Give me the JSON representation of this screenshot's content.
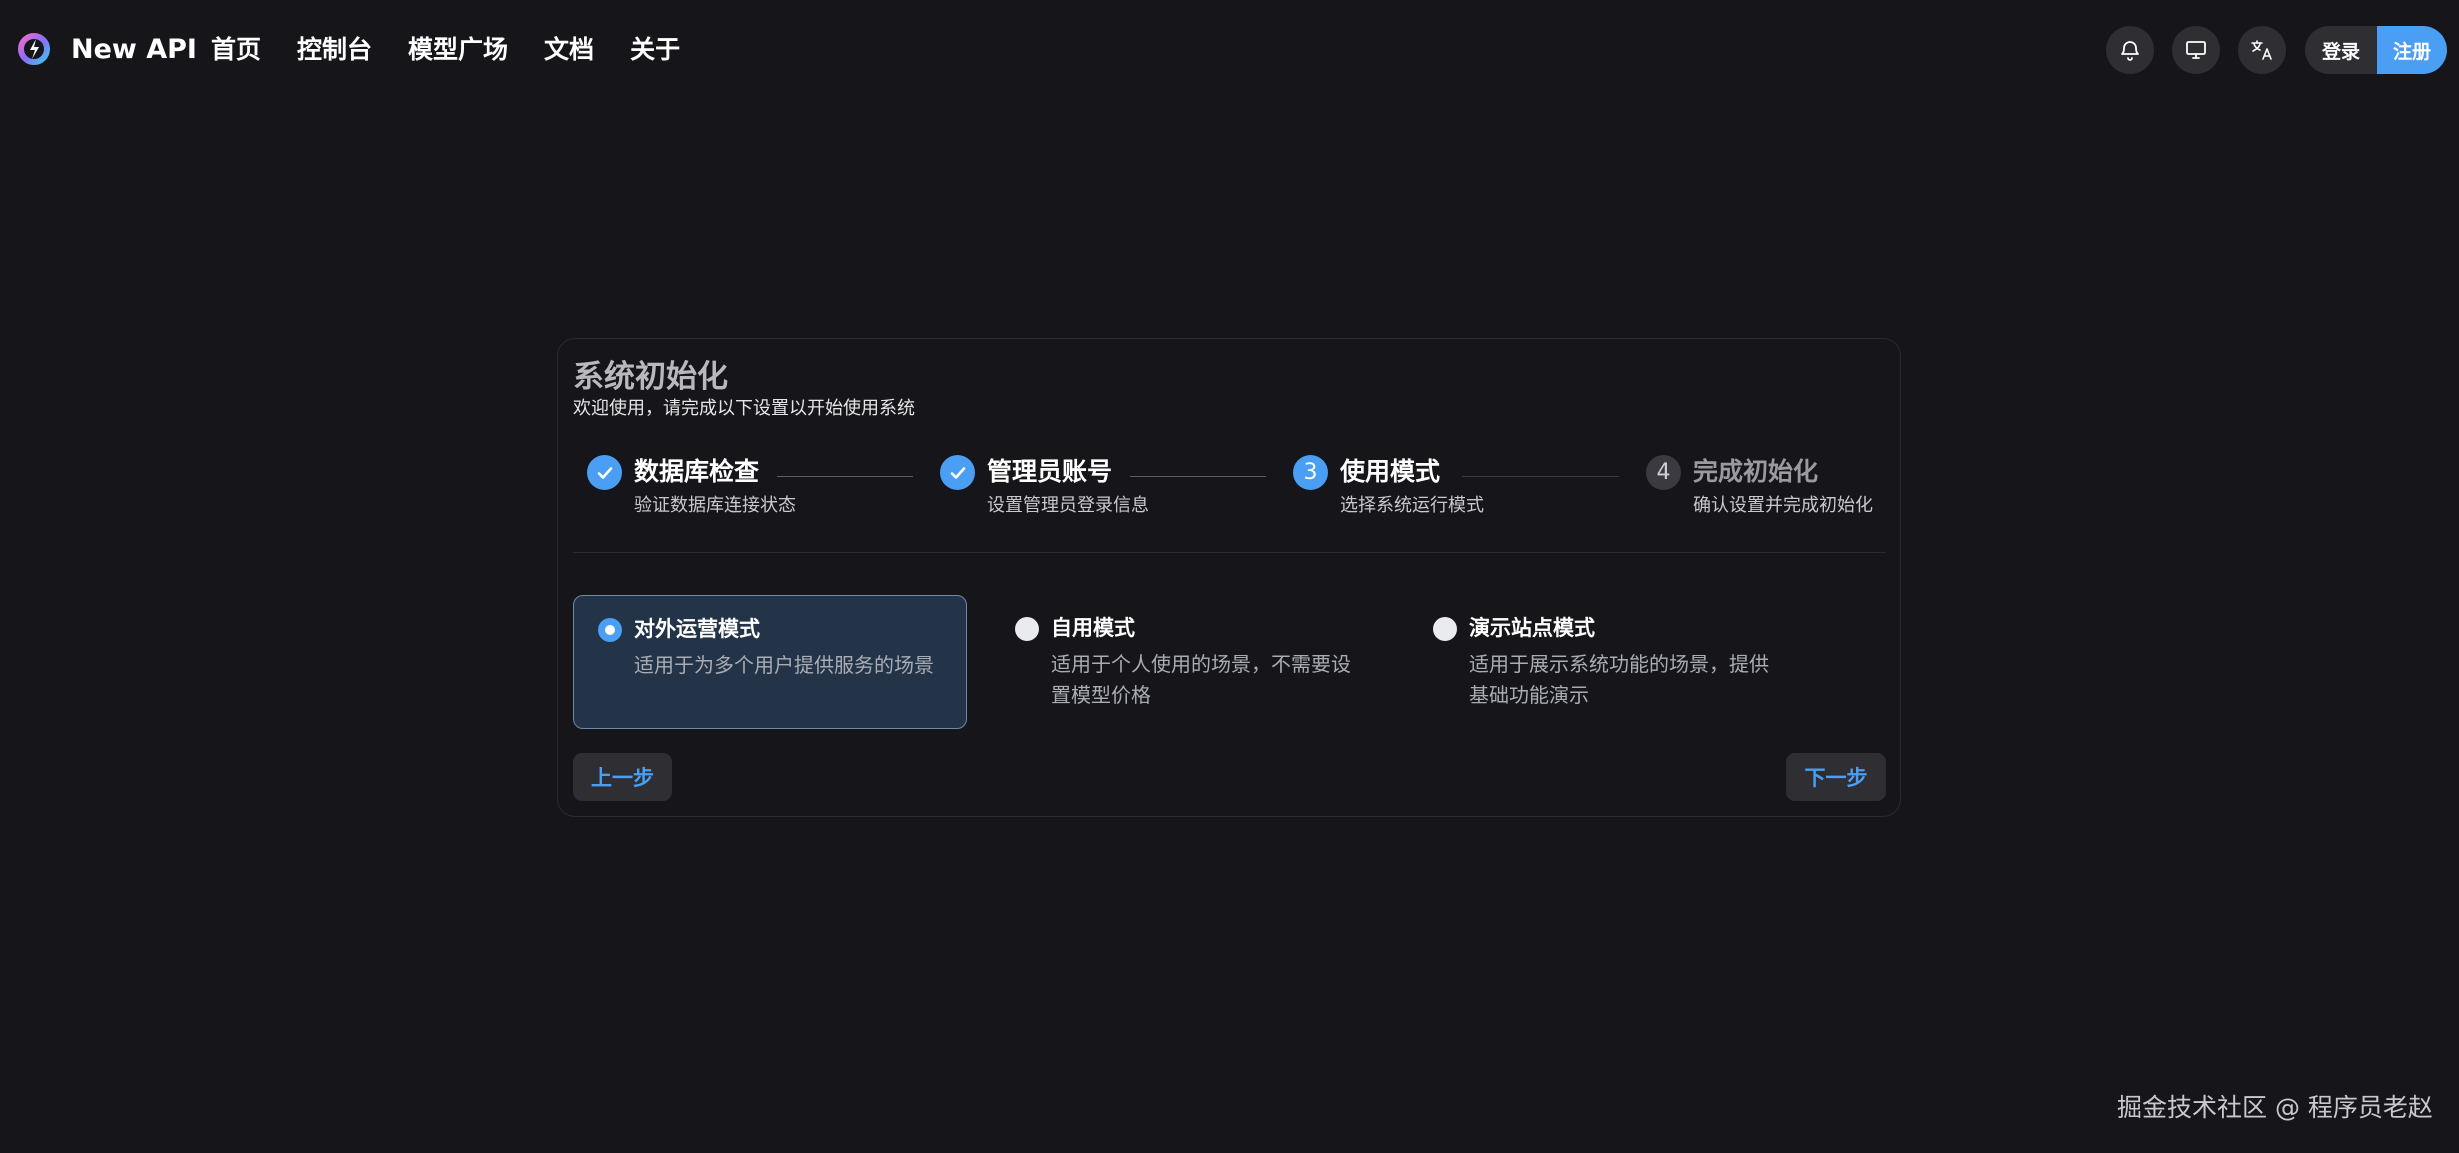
{
  "header": {
    "brand": "New API",
    "nav": [
      "首页",
      "控制台",
      "模型广场",
      "文档",
      "关于"
    ],
    "icons": [
      "bell-icon",
      "monitor-icon",
      "translate-icon"
    ],
    "login_label": "登录",
    "register_label": "注册"
  },
  "setup": {
    "title": "系统初始化",
    "subtitle": "欢迎使用，请完成以下设置以开始使用系统",
    "steps": [
      {
        "number": "1",
        "title": "数据库检查",
        "desc": "验证数据库连接状态",
        "status": "done"
      },
      {
        "number": "2",
        "title": "管理员账号",
        "desc": "设置管理员登录信息",
        "status": "done"
      },
      {
        "number": "3",
        "title": "使用模式",
        "desc": "选择系统运行模式",
        "status": "active"
      },
      {
        "number": "4",
        "title": "完成初始化",
        "desc": "确认设置并完成初始化",
        "status": "pending"
      }
    ],
    "options": [
      {
        "title": "对外运营模式",
        "desc": "适用于为多个用户提供服务的场景",
        "selected": true
      },
      {
        "title": "自用模式",
        "desc": "适用于个人使用的场景，不需要设置模型价格",
        "selected": false
      },
      {
        "title": "演示站点模式",
        "desc": "适用于展示系统功能的场景，提供基础功能演示",
        "selected": false
      }
    ],
    "prev_label": "上一步",
    "next_label": "下一步"
  },
  "watermark": "掘金技术社区 @ 程序员老赵",
  "colors": {
    "background": "#16161a",
    "accent": "#4a9ff5",
    "selected_option_bg": "#233448"
  }
}
